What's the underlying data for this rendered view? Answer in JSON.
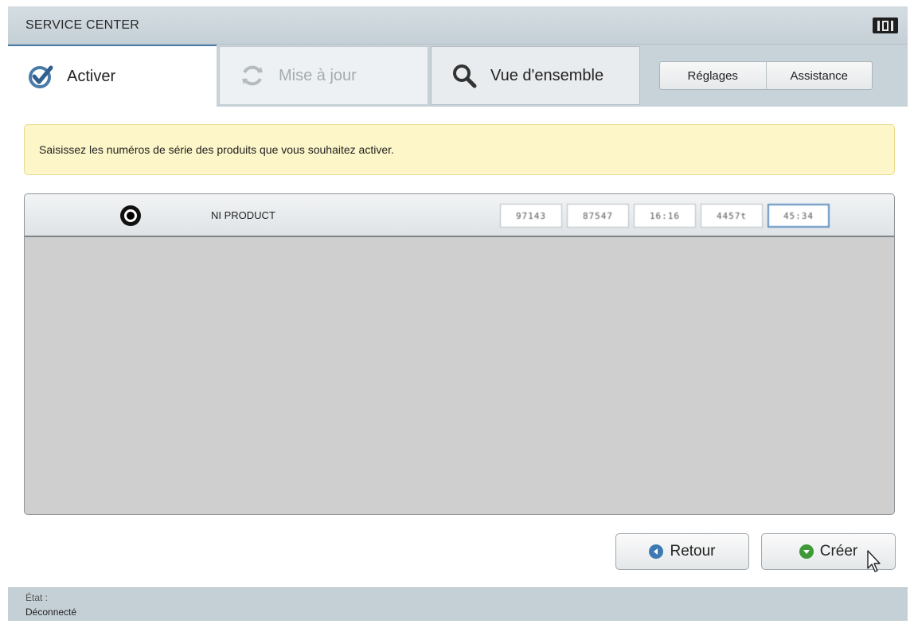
{
  "window": {
    "title": "SERVICE CENTER",
    "logo_icon": "ni-logo-icon"
  },
  "tabs": [
    {
      "label": "Activer",
      "icon": "checkmark-icon",
      "state": "active"
    },
    {
      "label": "Mise à jour",
      "icon": "refresh-icon",
      "state": "disabled"
    },
    {
      "label": "Vue d'ensemble",
      "icon": "magnifier-icon",
      "state": "normal"
    }
  ],
  "top_buttons": {
    "settings_label": "Réglages",
    "help_label": "Assistance"
  },
  "notice": {
    "message": "Saisissez les numéros de série des produits que vous souhaitez activer."
  },
  "product": {
    "name": "NI PRODUCT",
    "selected": true,
    "serial_fields": [
      "97143",
      "87547",
      "16:16",
      "4457t",
      "45:34"
    ]
  },
  "actions": {
    "back_label": "Retour",
    "create_label": "Créer"
  },
  "status": {
    "label": "État :",
    "value": "Déconnecté"
  },
  "colors": {
    "accent_blue": "#3f79b4",
    "create_green": "#3d9a36",
    "notice_bg": "#fcf6c8",
    "chrome": "#c8d3d9"
  }
}
